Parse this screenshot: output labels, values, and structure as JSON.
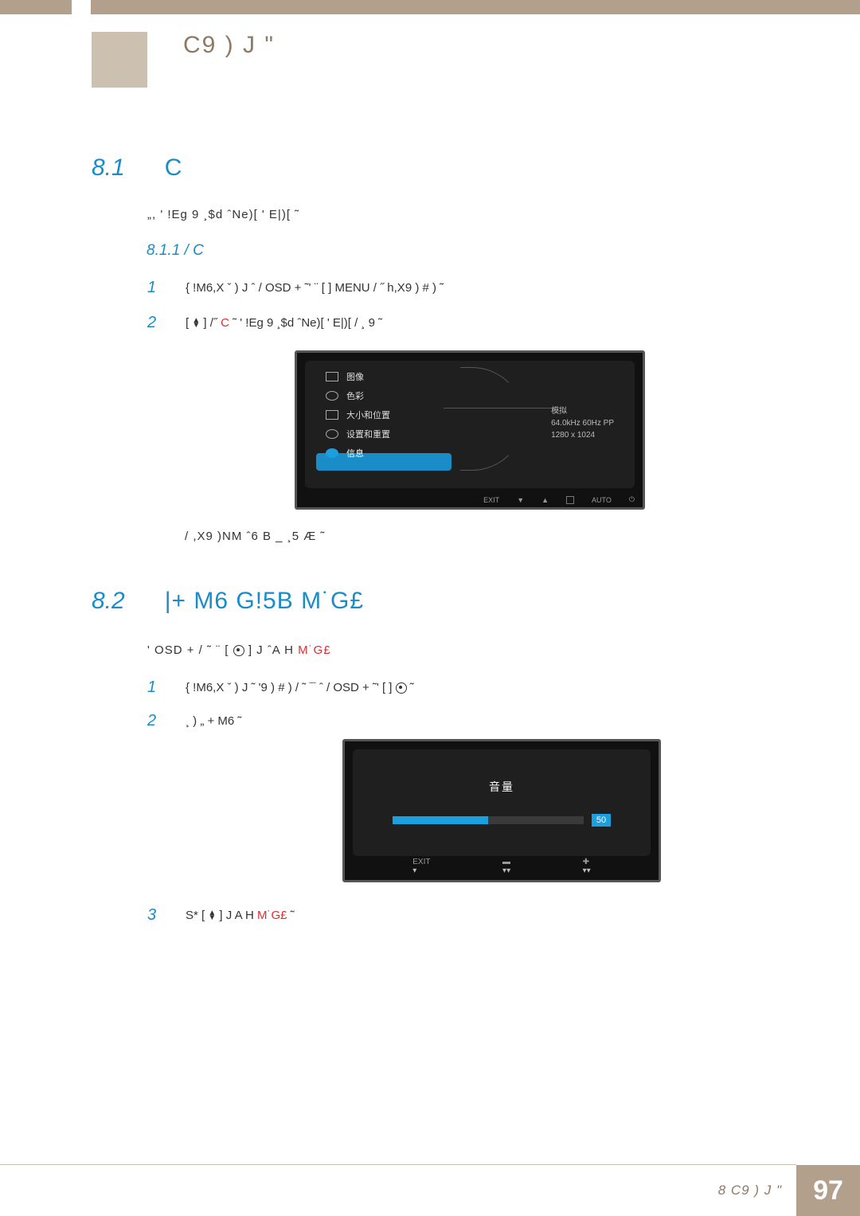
{
  "chapter": {
    "title": "C9  )   J \""
  },
  "section81": {
    "num": "8.1",
    "title": "C",
    "intro": "„, ' !Eg 9  ¸$d ˆNe)[ '  E|)[ ˜"
  },
  "subsection811": {
    "heading": "8.1.1       /   C"
  },
  "step81_1": "{ !M6,X ˇ )  J ˆ  /  OSD              + ˜'  ¨  [         ] MENU   / ˝ h,X9  ) # ) ˜",
  "step81_2_prefix": "[ ",
  "step81_2_mid": " ] /˝      ",
  "step81_2_hl": "C",
  "step81_2_suffix": " ˜ ' !Eg 9  ¸$d ˆNe)[ '  E|)[      / ¸ 9 ˜",
  "osd1": {
    "items": [
      "图像",
      "色彩",
      "大小和位置",
      "设置和重置",
      "信息"
    ],
    "right_mode": "模拟",
    "right_line1": "64.0kHz 60Hz PP",
    "right_line2": "1280 x 1024",
    "bottom": [
      "EXIT",
      "▼",
      "▲",
      "",
      "AUTO",
      "⏻"
    ]
  },
  "after_osd1": "/ ,X9 )NM ˆ6   B _ ¸5       Æ  ˜",
  "section82": {
    "num": "8.2",
    "title": "|+ M6  G!5B      M˙G£",
    "intro_pre": "'  OSD    +  / ˜ ¨         [",
    "intro_mid": "]  J ˆA  H   ",
    "intro_hl": "M˙G£"
  },
  "step82_1": "{ !M6,X ˇ )  J ˜ '9  ) # )    / ˜ ¯ ˆ  /  OSD                       + ˜'      [    ]",
  "step82_2": "¸ )  „  + M6 ˜",
  "osd2": {
    "title": "音量",
    "value": "50",
    "bottom_labels": [
      "EXIT",
      "▬",
      "✚"
    ],
    "bottom_arrows": [
      "▾",
      "▾▾",
      "▾▾"
    ]
  },
  "step82_3_pre": "S*   [ ",
  "step82_3_mid": " ]   J A  H  ",
  "step82_3_hl": "M˙G£",
  "step82_3_suffix": " ˜",
  "footer": {
    "text": "8   C9  )   J \"",
    "page": "97"
  }
}
